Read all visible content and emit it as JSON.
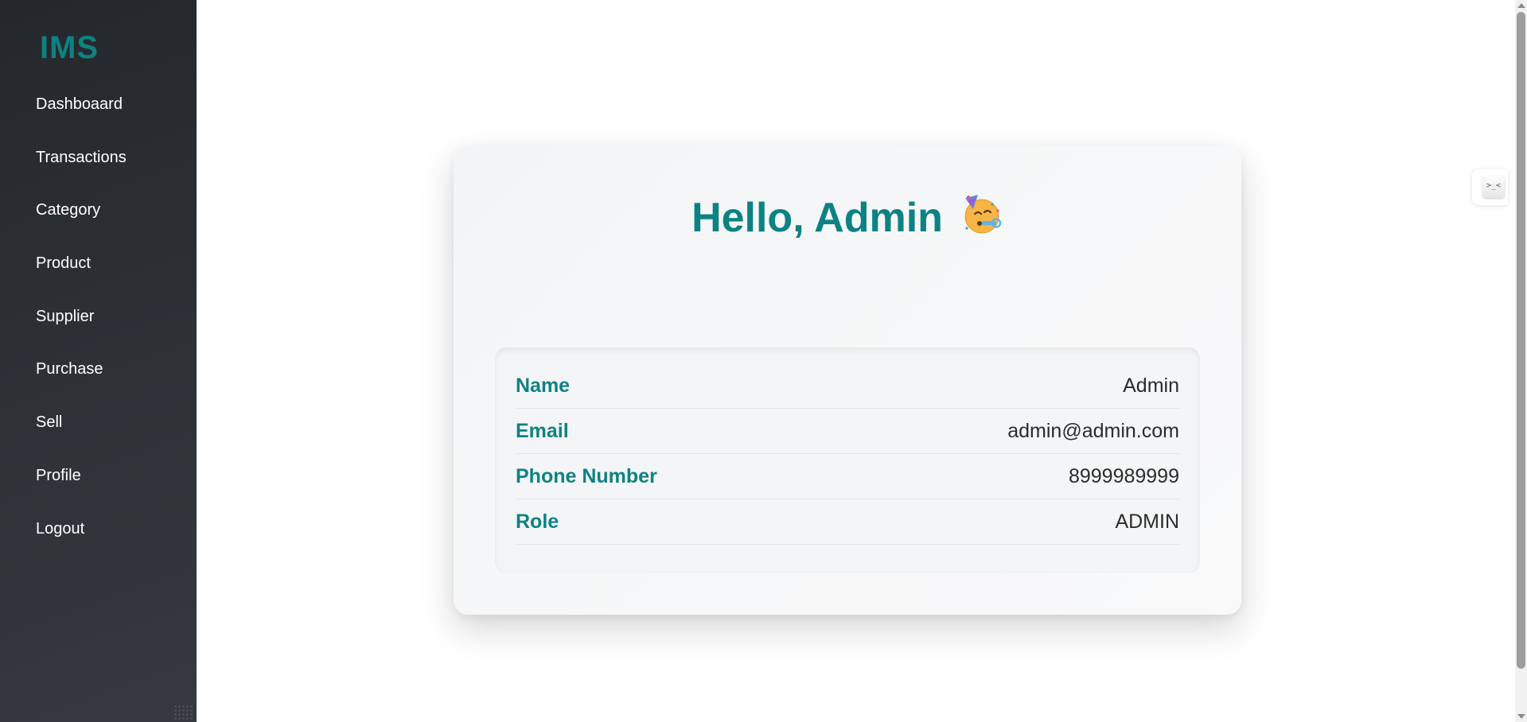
{
  "brand": {
    "title": "IMS",
    "color": "#0d8282"
  },
  "sidebar": {
    "items": [
      {
        "label": "Dashboaard"
      },
      {
        "label": "Transactions"
      },
      {
        "label": "Category"
      },
      {
        "label": "Product"
      },
      {
        "label": "Supplier"
      },
      {
        "label": "Purchase"
      },
      {
        "label": "Sell"
      },
      {
        "label": "Profile"
      },
      {
        "label": "Logout"
      }
    ]
  },
  "profile": {
    "greeting": "Hello, Admin",
    "greeting_emoji": "partying-face-icon",
    "fields": [
      {
        "label": "Name",
        "value": "Admin"
      },
      {
        "label": "Email",
        "value": "admin@admin.com"
      },
      {
        "label": "Phone Number",
        "value": "8999989999"
      },
      {
        "label": "Role",
        "value": "ADMIN"
      }
    ]
  },
  "widget": {
    "glyph": ">_<"
  },
  "colors": {
    "accent": "#0d8282",
    "sidebar_bg": "#2d3237",
    "card_bg": "#f4f5f6"
  }
}
